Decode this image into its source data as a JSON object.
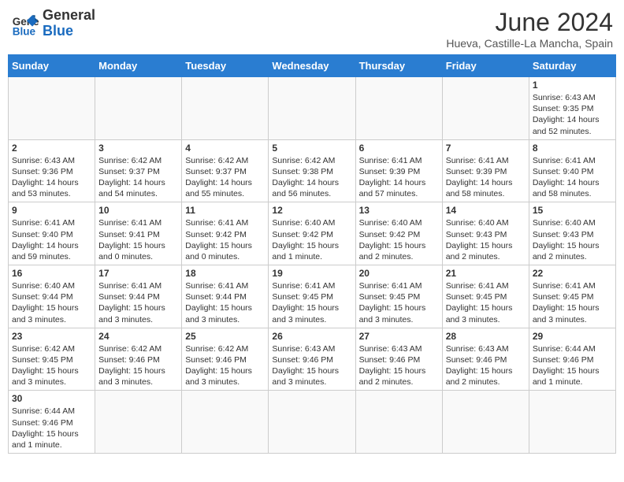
{
  "header": {
    "logo_general": "General",
    "logo_blue": "Blue",
    "title": "June 2024",
    "subtitle": "Hueva, Castille-La Mancha, Spain"
  },
  "weekdays": [
    "Sunday",
    "Monday",
    "Tuesday",
    "Wednesday",
    "Thursday",
    "Friday",
    "Saturday"
  ],
  "weeks": [
    [
      {
        "day": "",
        "info": ""
      },
      {
        "day": "",
        "info": ""
      },
      {
        "day": "",
        "info": ""
      },
      {
        "day": "",
        "info": ""
      },
      {
        "day": "",
        "info": ""
      },
      {
        "day": "",
        "info": ""
      },
      {
        "day": "1",
        "info": "Sunrise: 6:43 AM\nSunset: 9:35 PM\nDaylight: 14 hours and 52 minutes."
      }
    ],
    [
      {
        "day": "2",
        "info": "Sunrise: 6:43 AM\nSunset: 9:36 PM\nDaylight: 14 hours and 53 minutes."
      },
      {
        "day": "3",
        "info": "Sunrise: 6:42 AM\nSunset: 9:37 PM\nDaylight: 14 hours and 54 minutes."
      },
      {
        "day": "4",
        "info": "Sunrise: 6:42 AM\nSunset: 9:37 PM\nDaylight: 14 hours and 55 minutes."
      },
      {
        "day": "5",
        "info": "Sunrise: 6:42 AM\nSunset: 9:38 PM\nDaylight: 14 hours and 56 minutes."
      },
      {
        "day": "6",
        "info": "Sunrise: 6:41 AM\nSunset: 9:39 PM\nDaylight: 14 hours and 57 minutes."
      },
      {
        "day": "7",
        "info": "Sunrise: 6:41 AM\nSunset: 9:39 PM\nDaylight: 14 hours and 58 minutes."
      },
      {
        "day": "8",
        "info": "Sunrise: 6:41 AM\nSunset: 9:40 PM\nDaylight: 14 hours and 58 minutes."
      }
    ],
    [
      {
        "day": "9",
        "info": "Sunrise: 6:41 AM\nSunset: 9:40 PM\nDaylight: 14 hours and 59 minutes."
      },
      {
        "day": "10",
        "info": "Sunrise: 6:41 AM\nSunset: 9:41 PM\nDaylight: 15 hours and 0 minutes."
      },
      {
        "day": "11",
        "info": "Sunrise: 6:41 AM\nSunset: 9:42 PM\nDaylight: 15 hours and 0 minutes."
      },
      {
        "day": "12",
        "info": "Sunrise: 6:40 AM\nSunset: 9:42 PM\nDaylight: 15 hours and 1 minute."
      },
      {
        "day": "13",
        "info": "Sunrise: 6:40 AM\nSunset: 9:42 PM\nDaylight: 15 hours and 2 minutes."
      },
      {
        "day": "14",
        "info": "Sunrise: 6:40 AM\nSunset: 9:43 PM\nDaylight: 15 hours and 2 minutes."
      },
      {
        "day": "15",
        "info": "Sunrise: 6:40 AM\nSunset: 9:43 PM\nDaylight: 15 hours and 2 minutes."
      }
    ],
    [
      {
        "day": "16",
        "info": "Sunrise: 6:40 AM\nSunset: 9:44 PM\nDaylight: 15 hours and 3 minutes."
      },
      {
        "day": "17",
        "info": "Sunrise: 6:41 AM\nSunset: 9:44 PM\nDaylight: 15 hours and 3 minutes."
      },
      {
        "day": "18",
        "info": "Sunrise: 6:41 AM\nSunset: 9:44 PM\nDaylight: 15 hours and 3 minutes."
      },
      {
        "day": "19",
        "info": "Sunrise: 6:41 AM\nSunset: 9:45 PM\nDaylight: 15 hours and 3 minutes."
      },
      {
        "day": "20",
        "info": "Sunrise: 6:41 AM\nSunset: 9:45 PM\nDaylight: 15 hours and 3 minutes."
      },
      {
        "day": "21",
        "info": "Sunrise: 6:41 AM\nSunset: 9:45 PM\nDaylight: 15 hours and 3 minutes."
      },
      {
        "day": "22",
        "info": "Sunrise: 6:41 AM\nSunset: 9:45 PM\nDaylight: 15 hours and 3 minutes."
      }
    ],
    [
      {
        "day": "23",
        "info": "Sunrise: 6:42 AM\nSunset: 9:45 PM\nDaylight: 15 hours and 3 minutes."
      },
      {
        "day": "24",
        "info": "Sunrise: 6:42 AM\nSunset: 9:46 PM\nDaylight: 15 hours and 3 minutes."
      },
      {
        "day": "25",
        "info": "Sunrise: 6:42 AM\nSunset: 9:46 PM\nDaylight: 15 hours and 3 minutes."
      },
      {
        "day": "26",
        "info": "Sunrise: 6:43 AM\nSunset: 9:46 PM\nDaylight: 15 hours and 3 minutes."
      },
      {
        "day": "27",
        "info": "Sunrise: 6:43 AM\nSunset: 9:46 PM\nDaylight: 15 hours and 2 minutes."
      },
      {
        "day": "28",
        "info": "Sunrise: 6:43 AM\nSunset: 9:46 PM\nDaylight: 15 hours and 2 minutes."
      },
      {
        "day": "29",
        "info": "Sunrise: 6:44 AM\nSunset: 9:46 PM\nDaylight: 15 hours and 1 minute."
      }
    ],
    [
      {
        "day": "30",
        "info": "Sunrise: 6:44 AM\nSunset: 9:46 PM\nDaylight: 15 hours and 1 minute."
      },
      {
        "day": "",
        "info": ""
      },
      {
        "day": "",
        "info": ""
      },
      {
        "day": "",
        "info": ""
      },
      {
        "day": "",
        "info": ""
      },
      {
        "day": "",
        "info": ""
      },
      {
        "day": "",
        "info": ""
      }
    ]
  ]
}
